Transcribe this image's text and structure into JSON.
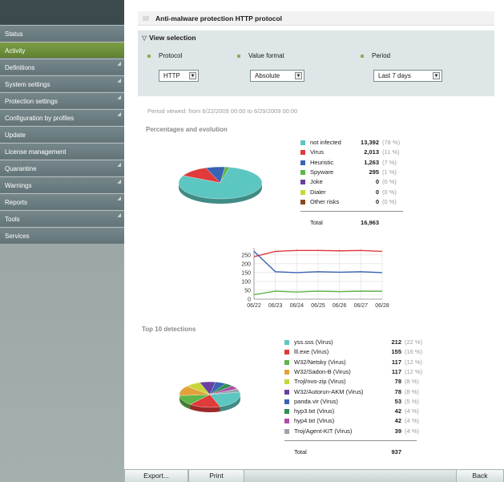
{
  "sidebar": {
    "items": [
      {
        "label": "Status",
        "submenu": false,
        "active": false
      },
      {
        "label": "Activity",
        "submenu": false,
        "active": true
      },
      {
        "label": "Definitions",
        "submenu": true,
        "active": false
      },
      {
        "label": "System settings",
        "submenu": true,
        "active": false
      },
      {
        "label": "Protection settings",
        "submenu": true,
        "active": false
      },
      {
        "label": "Configuration by profiles",
        "submenu": true,
        "active": false
      },
      {
        "label": "Update",
        "submenu": false,
        "active": false
      },
      {
        "label": "License management",
        "submenu": false,
        "active": false
      },
      {
        "label": "Quarantine",
        "submenu": true,
        "active": false
      },
      {
        "label": "Warnings",
        "submenu": true,
        "active": false
      },
      {
        "label": "Reports",
        "submenu": true,
        "active": false
      },
      {
        "label": "Tools",
        "submenu": true,
        "active": false
      },
      {
        "label": "Services",
        "submenu": false,
        "active": false
      }
    ]
  },
  "header": {
    "title": "Anti-malware protection HTTP protocol"
  },
  "view_selection": {
    "title": "View selection",
    "protocol_label": "Protocol",
    "protocol_value": "HTTP",
    "format_label": "Value format",
    "format_value": "Absolute",
    "period_label": "Period",
    "period_value": "Last 7 days"
  },
  "period_text": "Period viewed: from 6/22/2009 00:00 to 6/29/2009 00:00",
  "percentages": {
    "title": "Percentages and evolution",
    "items": [
      {
        "name": "not infected",
        "value": "13,392",
        "pct": "(78 %)",
        "color": "#5cc6c0"
      },
      {
        "name": "Virus",
        "value": "2,013",
        "pct": "(11 %)",
        "color": "#e03a3a"
      },
      {
        "name": "Heuristic",
        "value": "1,263",
        "pct": "(7 %)",
        "color": "#3a62b5"
      },
      {
        "name": "Spyware",
        "value": "295",
        "pct": "(1 %)",
        "color": "#5fb548"
      },
      {
        "name": "Joke",
        "value": "0",
        "pct": "(0 %)",
        "color": "#6a3fa0"
      },
      {
        "name": "Dialer",
        "value": "0",
        "pct": "(0 %)",
        "color": "#c8d63a"
      },
      {
        "name": "Other risks",
        "value": "0",
        "pct": "(0 %)",
        "color": "#8a4a1e"
      }
    ],
    "total_label": "Total",
    "total_value": "16,963"
  },
  "top10": {
    "title": "Top 10 detections",
    "items": [
      {
        "name": "yss.sss (Virus)",
        "value": "212",
        "pct": "(22 %)",
        "color": "#5cc6c0"
      },
      {
        "name": "lll.exe (Virus)",
        "value": "155",
        "pct": "(16 %)",
        "color": "#e03a3a"
      },
      {
        "name": "W32/Netsky (Virus)",
        "value": "117",
        "pct": "(12 %)",
        "color": "#5fb548"
      },
      {
        "name": "W32/Sadon-B (Virus)",
        "value": "117",
        "pct": "(12 %)",
        "color": "#e2a23a"
      },
      {
        "name": "Trojl/nvo-zip (Virus)",
        "value": "78",
        "pct": "(8 %)",
        "color": "#c8d63a"
      },
      {
        "name": "W32/Autorun-AKM (Virus)",
        "value": "78",
        "pct": "(8 %)",
        "color": "#6a3fa0"
      },
      {
        "name": "panda.vir (Virus)",
        "value": "53",
        "pct": "(5 %)",
        "color": "#3a62b5"
      },
      {
        "name": "hyp3.txt (Virus)",
        "value": "42",
        "pct": "(4 %)",
        "color": "#2f8f4f"
      },
      {
        "name": "hyp4.txt (Virus)",
        "value": "42",
        "pct": "(4 %)",
        "color": "#b04aa8"
      },
      {
        "name": "Troj/Agent-KIT (Virus)",
        "value": "39",
        "pct": "(4 %)",
        "color": "#9aa3b0"
      }
    ],
    "total_label": "Total",
    "total_value": "937"
  },
  "chart_data": [
    {
      "type": "pie",
      "categories": [
        "not infected",
        "Virus",
        "Heuristic",
        "Spyware",
        "Joke",
        "Dialer",
        "Other risks"
      ],
      "values": [
        13392,
        2013,
        1263,
        295,
        0,
        0,
        0
      ]
    },
    {
      "type": "line",
      "x": [
        "06/22",
        "06/23",
        "06/24",
        "06/25",
        "06/26",
        "06/27",
        "06/28"
      ],
      "yticks": [
        0,
        50,
        100,
        150,
        200,
        250
      ],
      "ylim": [
        0,
        290
      ],
      "grid": true,
      "series": [
        {
          "color": "#e03a3a",
          "values": [
            240,
            270,
            275,
            275,
            273,
            275,
            270
          ]
        },
        {
          "color": "#3a62b5",
          "values": [
            270,
            155,
            150,
            155,
            152,
            155,
            150
          ]
        },
        {
          "color": "#5fb548",
          "values": [
            25,
            45,
            40,
            45,
            42,
            45,
            44
          ]
        }
      ]
    },
    {
      "type": "pie",
      "categories": [
        "yss.sss (Virus)",
        "lll.exe (Virus)",
        "W32/Netsky (Virus)",
        "W32/Sadon-B (Virus)",
        "Trojl/nvo-zip (Virus)",
        "W32/Autorun-AKM (Virus)",
        "panda.vir (Virus)",
        "hyp3.txt (Virus)",
        "hyp4.txt (Virus)",
        "Troj/Agent-KIT (Virus)"
      ],
      "values": [
        212,
        155,
        117,
        117,
        78,
        78,
        53,
        42,
        42,
        39
      ]
    }
  ],
  "buttons": {
    "export": "Export...",
    "print": "Print",
    "back": "Back"
  }
}
